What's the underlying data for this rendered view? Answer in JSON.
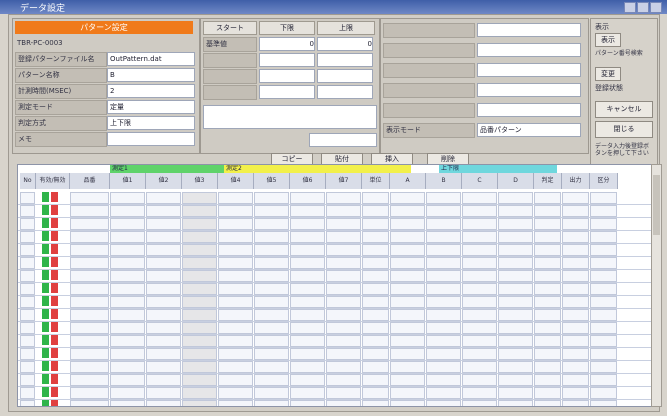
{
  "window": {
    "title": "データ設定"
  },
  "header_panel": {
    "banner_text": "パターン設定",
    "code": "TBR-PC-0003",
    "fields": [
      {
        "label": "登録パターンファイル名",
        "value": "OutPattern.dat"
      },
      {
        "label": "パターン名称",
        "value": "B"
      },
      {
        "label": "計測時間(MSEC)",
        "value": "2"
      },
      {
        "label": "測定モード",
        "value": "定量"
      },
      {
        "label": "判定方式",
        "value": "上下限"
      },
      {
        "label": "メモ",
        "value": ""
      }
    ]
  },
  "top_middle": {
    "headers": [
      "スタート",
      "下限",
      "上限"
    ],
    "rows": [
      {
        "label": "基準値",
        "values": [
          "0",
          "0"
        ]
      },
      {
        "label": "",
        "values": [
          "",
          ""
        ]
      },
      {
        "label": "",
        "values": [
          "",
          ""
        ]
      },
      {
        "label": "",
        "values": [
          "",
          ""
        ]
      }
    ]
  },
  "top_right": {
    "rows": [
      {
        "label": "",
        "value": ""
      },
      {
        "label": "",
        "value": ""
      },
      {
        "label": "",
        "value": ""
      },
      {
        "label": "",
        "value": ""
      },
      {
        "label": "",
        "value": ""
      },
      {
        "label": "表示モード",
        "value": "品番パターン"
      }
    ]
  },
  "side_panel": {
    "label_top": "表示",
    "btn_show": "表示",
    "label_pattern": "パターン番号検索",
    "btn_edit": "変更",
    "label_status": "登録状態",
    "btn_cancel": "キャンセル",
    "btn_close": "閉じる",
    "note": "データ入力後登録ボタンを押して下さい"
  },
  "toolbar": {
    "copy": "コピー",
    "paste": "貼付",
    "insert": "挿入",
    "delete": "削除"
  },
  "grid": {
    "group_a": "測定1",
    "group_b": "測定2",
    "group_c": "上下限",
    "columns": [
      "No",
      "有効/無効",
      "品番",
      "値1",
      "値2",
      "値3",
      "値4",
      "値5",
      "値6",
      "値7",
      "単位",
      "A",
      "B",
      "C",
      "D",
      "判定",
      "出力",
      "区分"
    ],
    "row_count": 17
  }
}
